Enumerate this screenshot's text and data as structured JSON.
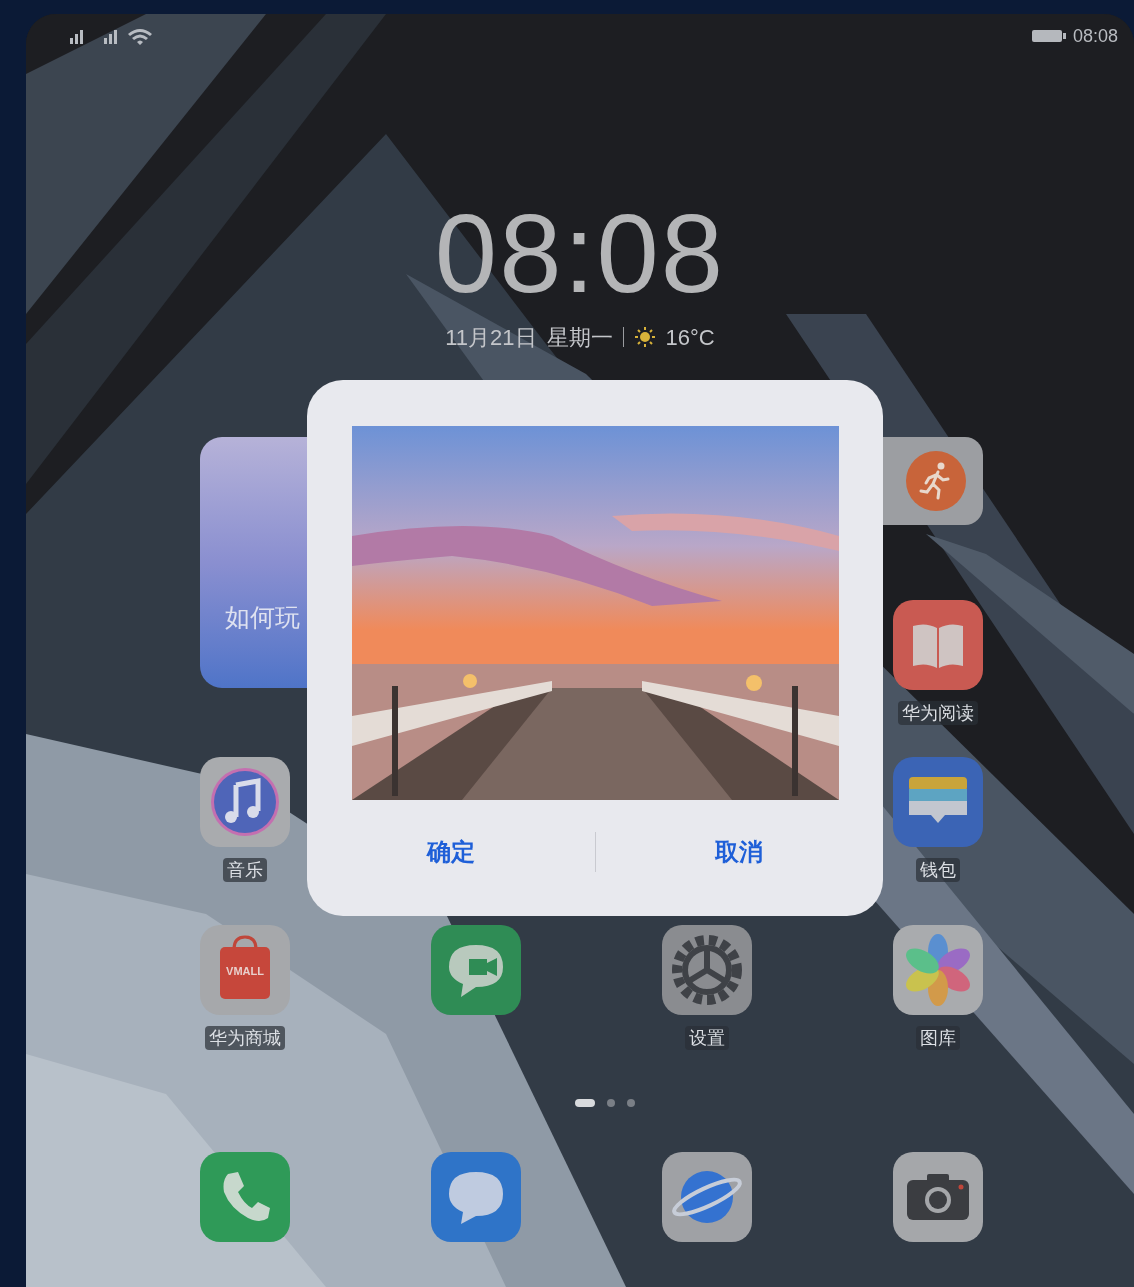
{
  "status_bar": {
    "time": "08:08"
  },
  "clock": {
    "time": "08:08",
    "date": "11月21日",
    "weekday": "星期一",
    "temperature": "16°C"
  },
  "widget": {
    "label": "如何玩"
  },
  "apps": [
    {
      "label": "华为阅读"
    },
    {
      "label": "音乐"
    },
    {
      "label": "钱包"
    },
    {
      "label": "华为商城",
      "badge": "VMALL"
    },
    {
      "label": "设置"
    },
    {
      "label": "图库"
    }
  ],
  "pages": [
    {
      "selected": true
    },
    {
      "selected": false
    },
    {
      "selected": false
    }
  ],
  "dialog": {
    "buttons": [
      "确定",
      "取消"
    ]
  }
}
